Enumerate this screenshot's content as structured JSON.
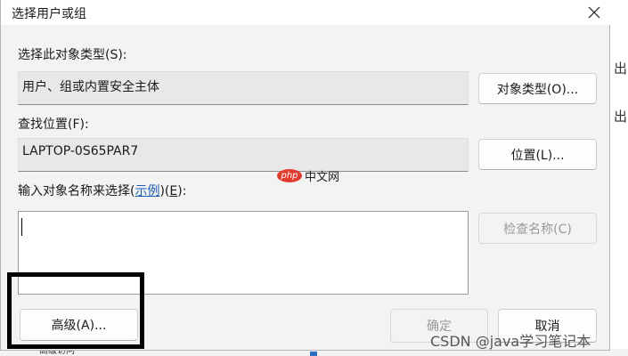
{
  "dialog": {
    "title": "选择用户或组",
    "object_type_label": "选择此对象类型(S):",
    "object_type_value": "用户、组或内置安全主体",
    "object_type_button": "对象类型(O)...",
    "location_label": "查找位置(F):",
    "location_value": "LAPTOP-0S65PAR7",
    "location_button": "位置(L)...",
    "enter_names_prefix": "输入对象名称来选择(",
    "examples_link": "示例",
    "enter_names_mid": ")(",
    "enter_names_key": "E",
    "enter_names_suffix": "):",
    "names_input_value": "",
    "check_names_button": "检查名称(C)",
    "advanced_button": "高级(A)...",
    "ok_button": "确定",
    "cancel_button": "取消"
  },
  "background": {
    "right_char_1": "出",
    "right_char_2": "出",
    "bottom_text": "高级访问"
  },
  "watermark": {
    "php_badge": "php",
    "php_text": "中文网",
    "csdn_text": "CSDN @java学习笔记本"
  },
  "colors": {
    "dialog_bg": "#f3f3f3",
    "link": "#1a5fb4",
    "annotation_box": "#000000",
    "php_badge_bg": "#e23a2e"
  },
  "icons": {
    "close": "close-icon"
  }
}
